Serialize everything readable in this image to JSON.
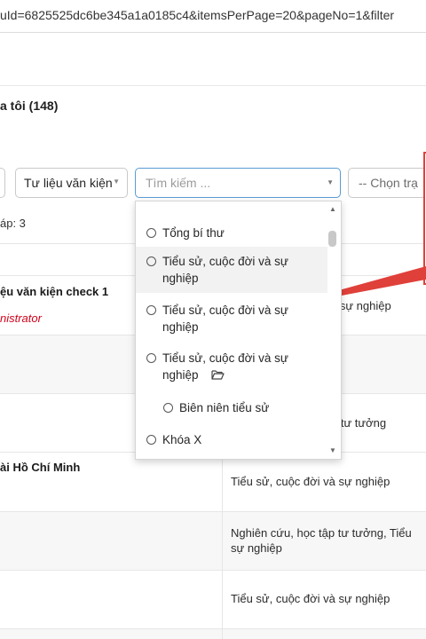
{
  "browser": {
    "url": "uId=6825525dc6be345a1a0185c4&itemsPerPage=20&pageNo=1&filter"
  },
  "page": {
    "title": "a tôi (148)",
    "answers_label": "áp: 3"
  },
  "filters": {
    "doc_type": "Tư liệu văn kiện",
    "search_placeholder": "Tìm kiếm ...",
    "status_placeholder": "-- Chọn trạ"
  },
  "dropdown": {
    "options": [
      {
        "label_1": "Tổng bí thư",
        "label_2": ""
      },
      {
        "label_1": "Tiểu sử, cuộc đời và sự",
        "label_2": "nghiệp"
      },
      {
        "label_1": "Tiểu sử, cuộc đời và sự",
        "label_2": "nghiệp"
      },
      {
        "label_1": "Tiểu sử, cuộc đời và sự",
        "label_2": "nghiệp"
      },
      {
        "label_1": "Biên niên tiểu sử",
        "label_2": ""
      },
      {
        "label_1": "Khóa X",
        "label_2": ""
      }
    ]
  },
  "table": {
    "rows": [
      {
        "left_title": "ệu văn kiện check 1",
        "left_sub": "nistrator",
        "right": "à sự nghiệp"
      },
      {
        "left_title": "",
        "left_sub": "",
        "right": ""
      },
      {
        "left_title": "",
        "left_sub": "",
        "right": "p tư tưởng"
      },
      {
        "left_title": "ài Hồ Chí Minh",
        "left_sub": "",
        "right": "Tiểu sử, cuộc đời và sự nghiệp"
      },
      {
        "left_title": "",
        "left_sub": "",
        "right_1": "Nghiên cứu, học tập tư tưởng, Tiểu",
        "right_2": "sự nghiệp"
      },
      {
        "left_title": "",
        "left_sub": "",
        "right": "Tiểu sử, cuộc đời và sự nghiệp"
      }
    ]
  },
  "colors": {
    "callout": "#e0403a",
    "highlight": "#f2f2f2",
    "admin_red": "#d0021b"
  }
}
